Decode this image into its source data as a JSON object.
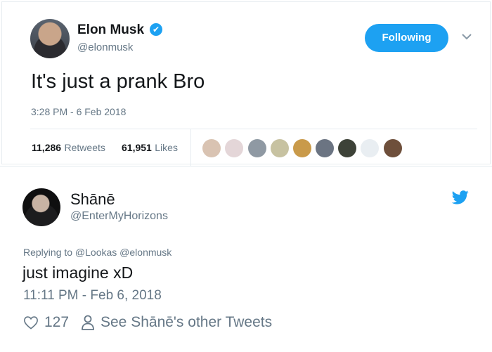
{
  "original_tweet": {
    "author_name": "Elon Musk",
    "handle": "@elonmusk",
    "verified_badge": "✔",
    "follow_label": "Following",
    "text": "It's just a prank Bro",
    "timestamp": "3:28 PM - 6 Feb 2018",
    "retweets_count": "11,286",
    "retweets_label": "Retweets",
    "likes_count": "61,951",
    "likes_label": "Likes",
    "icons": {
      "verified": "verified-icon",
      "caret": "chevron-down-icon"
    },
    "likers": [
      "liker-1",
      "liker-2",
      "liker-3",
      "liker-4",
      "liker-5",
      "liker-6",
      "liker-7",
      "liker-8",
      "liker-9"
    ]
  },
  "reply_tweet": {
    "author_name": "Shānē",
    "handle": "@EnterMyHorizons",
    "replying_to": "Replying to @Lookas @elonmusk",
    "text": "just imagine xD",
    "timestamp": "11:11 PM - Feb 6, 2018",
    "like_count": "127",
    "other_tweets_label": "See Shānē's other Tweets",
    "icons": {
      "bird": "twitter-bird-icon",
      "heart": "heart-icon",
      "person": "person-icon"
    }
  },
  "colors": {
    "accent": "#1da1f2",
    "secondary_text": "#657786",
    "primary_text": "#14171a"
  }
}
